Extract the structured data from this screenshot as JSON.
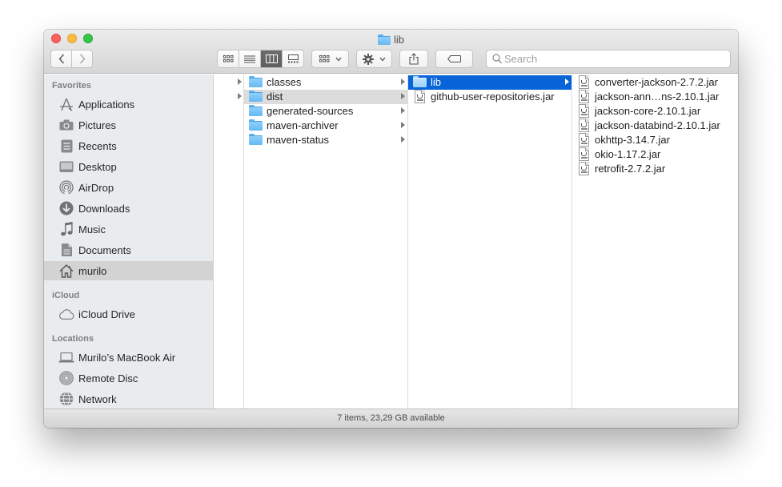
{
  "window": {
    "title": "lib"
  },
  "toolbar": {
    "back": "chevron-left",
    "forward": "chevron-right",
    "views": [
      "icon-view",
      "list-view",
      "column-view",
      "gallery-view"
    ],
    "active_view": "column-view",
    "search": {
      "placeholder": "Search",
      "value": ""
    }
  },
  "sidebar": {
    "sections": [
      {
        "title": "Favorites",
        "items": [
          {
            "label": "Applications",
            "icon": "applications-icon"
          },
          {
            "label": "Pictures",
            "icon": "camera-icon"
          },
          {
            "label": "Recents",
            "icon": "recents-icon"
          },
          {
            "label": "Desktop",
            "icon": "desktop-icon"
          },
          {
            "label": "AirDrop",
            "icon": "airdrop-icon"
          },
          {
            "label": "Downloads",
            "icon": "downloads-icon"
          },
          {
            "label": "Music",
            "icon": "music-note-icon"
          },
          {
            "label": "Documents",
            "icon": "documents-icon"
          },
          {
            "label": "murilo",
            "icon": "home-icon",
            "selected": true
          }
        ]
      },
      {
        "title": "iCloud",
        "items": [
          {
            "label": "iCloud Drive",
            "icon": "cloud-icon"
          }
        ]
      },
      {
        "title": "Locations",
        "items": [
          {
            "label": "Murilo’s MacBook Air",
            "icon": "laptop-icon"
          },
          {
            "label": "Remote Disc",
            "icon": "disc-icon"
          },
          {
            "label": "Network",
            "icon": "globe-icon"
          }
        ]
      }
    ]
  },
  "columns": [
    {
      "items": [
        {
          "label": "classes",
          "type": "folder"
        },
        {
          "label": "dist",
          "type": "folder",
          "state": "highlighted"
        },
        {
          "label": "generated-sources",
          "type": "folder"
        },
        {
          "label": "maven-archiver",
          "type": "folder"
        },
        {
          "label": "maven-status",
          "type": "folder"
        }
      ]
    },
    {
      "items": [
        {
          "label": "lib",
          "type": "folder",
          "state": "selected"
        },
        {
          "label": "github-user-repositories.jar",
          "type": "jar"
        }
      ]
    },
    {
      "items": [
        {
          "label": "converter-jackson-2.7.2.jar",
          "type": "jar"
        },
        {
          "label": "jackson-ann…ns-2.10.1.jar",
          "type": "jar"
        },
        {
          "label": "jackson-core-2.10.1.jar",
          "type": "jar"
        },
        {
          "label": "jackson-databind-2.10.1.jar",
          "type": "jar"
        },
        {
          "label": "okhttp-3.14.7.jar",
          "type": "jar"
        },
        {
          "label": "okio-1.17.2.jar",
          "type": "jar"
        },
        {
          "label": "retrofit-2.7.2.jar",
          "type": "jar"
        }
      ]
    }
  ],
  "status": {
    "text": "7 items, 23,29 GB available"
  },
  "colors": {
    "selection": "#0963d9",
    "sidebar_bg": "#e8ecef",
    "folder": "#65b8f2"
  }
}
